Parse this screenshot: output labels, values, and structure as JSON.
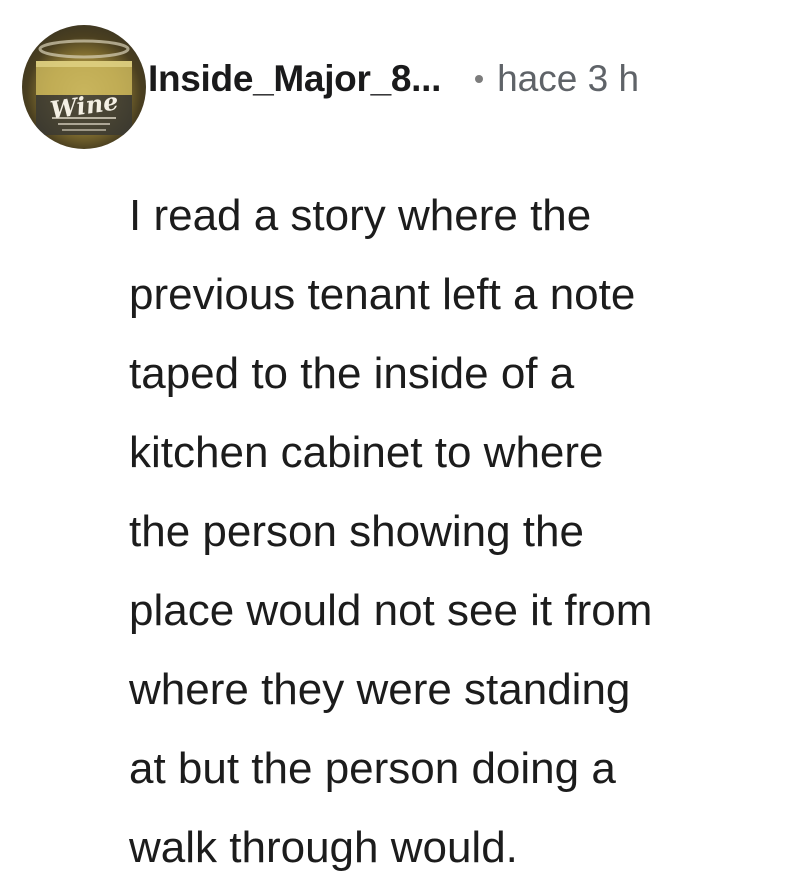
{
  "comment": {
    "author": {
      "username": "Inside_Major_8...",
      "avatar_text": "Wine"
    },
    "separator": "•",
    "timestamp": "hace 3 h",
    "body_lines": [
      "I read a story where the",
      "previous tenant left a note",
      "taped to the inside of a",
      "kitchen cabinet to where",
      "the person showing the",
      "place would not see it from",
      "where they were standing",
      "at but the person doing a",
      "walk through would."
    ]
  }
}
